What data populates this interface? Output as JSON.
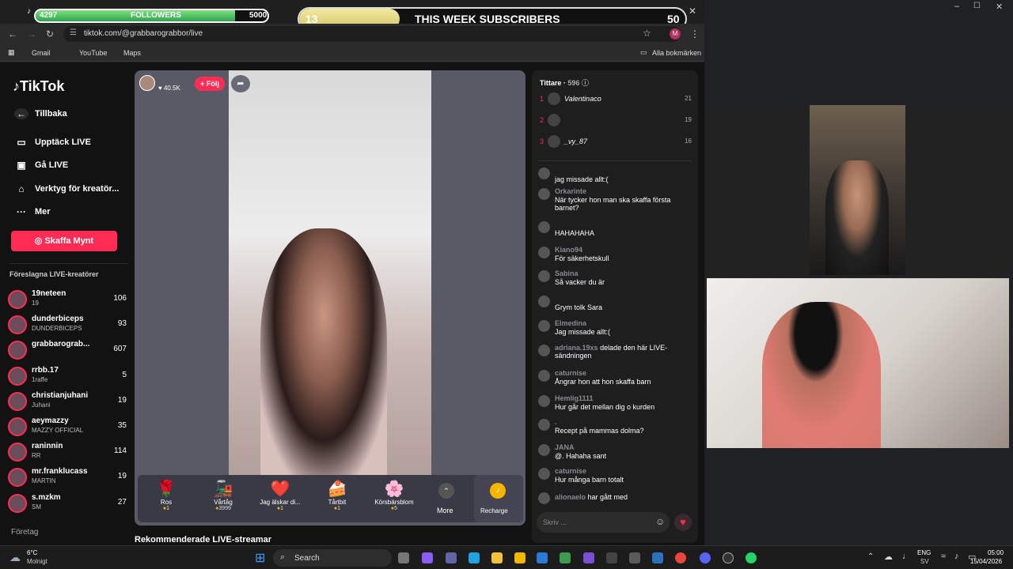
{
  "overlay": {
    "followers": {
      "label": "FOLLOWERS",
      "current": "4297",
      "goal": "5000",
      "progress": 0.86
    },
    "subscribers": {
      "label": "THIS WEEK SUBSCRIBERS",
      "current": "13",
      "goal": "50",
      "progress": 0.26
    }
  },
  "browser": {
    "url": "tiktok.com/@grabbarograbbor/live",
    "bookmarks": [
      "Gmail",
      "YouTube",
      "Maps"
    ],
    "all_bookmarks": "Alla bokmärken",
    "profile_initial": "M"
  },
  "sidebar": {
    "logo": "TikTok",
    "back": "Tillbaka",
    "nav": [
      {
        "label": "Upptäck LIVE",
        "icon": "tv-icon"
      },
      {
        "label": "Gå LIVE",
        "icon": "camera-icon"
      },
      {
        "label": "Verktyg för kreatör...",
        "icon": "creator-tools-icon"
      },
      {
        "label": "Mer",
        "icon": "more-icon"
      }
    ],
    "coins_button": "Skaffa Mynt",
    "suggested_title": "Föreslagna LIVE-kreatörer",
    "creators": [
      {
        "name": "19neteen",
        "sub": "19",
        "count": "106"
      },
      {
        "name": "dunderbiceps",
        "sub": "DUNDERBICEPS",
        "count": "93"
      },
      {
        "name": "grabbarograb...",
        "sub": "",
        "count": "607"
      },
      {
        "name": "rrbb.17",
        "sub": "1raffe",
        "count": "5"
      },
      {
        "name": "christianjuhani",
        "sub": "Juhani",
        "count": "19"
      },
      {
        "name": "aeymazzy",
        "sub": "MAZZY OFFICIAL",
        "count": "35"
      },
      {
        "name": "raninnin",
        "sub": "RR",
        "count": "114"
      },
      {
        "name": "mr.franklucass",
        "sub": "MARTIN",
        "count": "19"
      },
      {
        "name": "s.mzkm",
        "sub": "SM",
        "count": "27"
      }
    ],
    "footer": "Företag"
  },
  "stream": {
    "likes": "40.5K",
    "follow": "+ Följ",
    "recommended": "Rekommenderade LIVE-streamar"
  },
  "gifts": [
    {
      "name": "Ros",
      "price": "1",
      "icon": "🌹"
    },
    {
      "name": "Vårtåg",
      "price": "3999",
      "icon": "🚂"
    },
    {
      "name": "Jag älskar di...",
      "price": "1",
      "icon": "❤️"
    },
    {
      "name": "Tårtbit",
      "price": "1",
      "icon": "🍰"
    },
    {
      "name": "Körsbärsblom",
      "price": "5",
      "icon": "🌸"
    }
  ],
  "gift_more": "More",
  "recharge": "Recharge",
  "chat": {
    "viewers_label": "Tittare",
    "viewers_count": "596",
    "top_viewers": [
      {
        "rank": "1",
        "name": "Valentinaco",
        "score": "21"
      },
      {
        "rank": "2",
        "name": "",
        "score": "19"
      },
      {
        "rank": "3",
        "name": "_vy_87",
        "score": "16"
      }
    ],
    "messages": [
      {
        "user": "",
        "text": "jag missade allt:("
      },
      {
        "user": "Orkarinte",
        "text": "När tycker hon man ska skaffa första barnet?"
      },
      {
        "user": "",
        "text": "HAHAHAHA"
      },
      {
        "user": "Kiano94",
        "text": "För säkerhetskull"
      },
      {
        "user": "Sabina",
        "text": "Så vacker du är"
      },
      {
        "user": "",
        "text": "Grym tolk Sara"
      },
      {
        "user": "Elmedina",
        "text": "Jag missade allt:("
      },
      {
        "user": "adriana.19xs",
        "text": "delade den här LIVE-sändningen"
      },
      {
        "user": "caturnise",
        "text": "Ångrar hon att hon skaffa barn"
      },
      {
        "user": "Hemlig1111",
        "text": "Hur går det mellan dig o kurden"
      },
      {
        "user": ".",
        "text": "Recept på mammas dolma?"
      },
      {
        "user": "JANA",
        "text": "@. Hahaha sant"
      },
      {
        "user": "caturnise",
        "text": "Hur många barn totalt"
      },
      {
        "user": "alionaelo",
        "text": "har gått med"
      }
    ],
    "input_placeholder": "Skriv ..."
  },
  "taskbar": {
    "weather_temp": "6°C",
    "weather_desc": "Molnigt",
    "search": "Search",
    "lang": "ENG",
    "lang_sub": "SV",
    "time": "05:00",
    "date": "15/04/2026"
  }
}
